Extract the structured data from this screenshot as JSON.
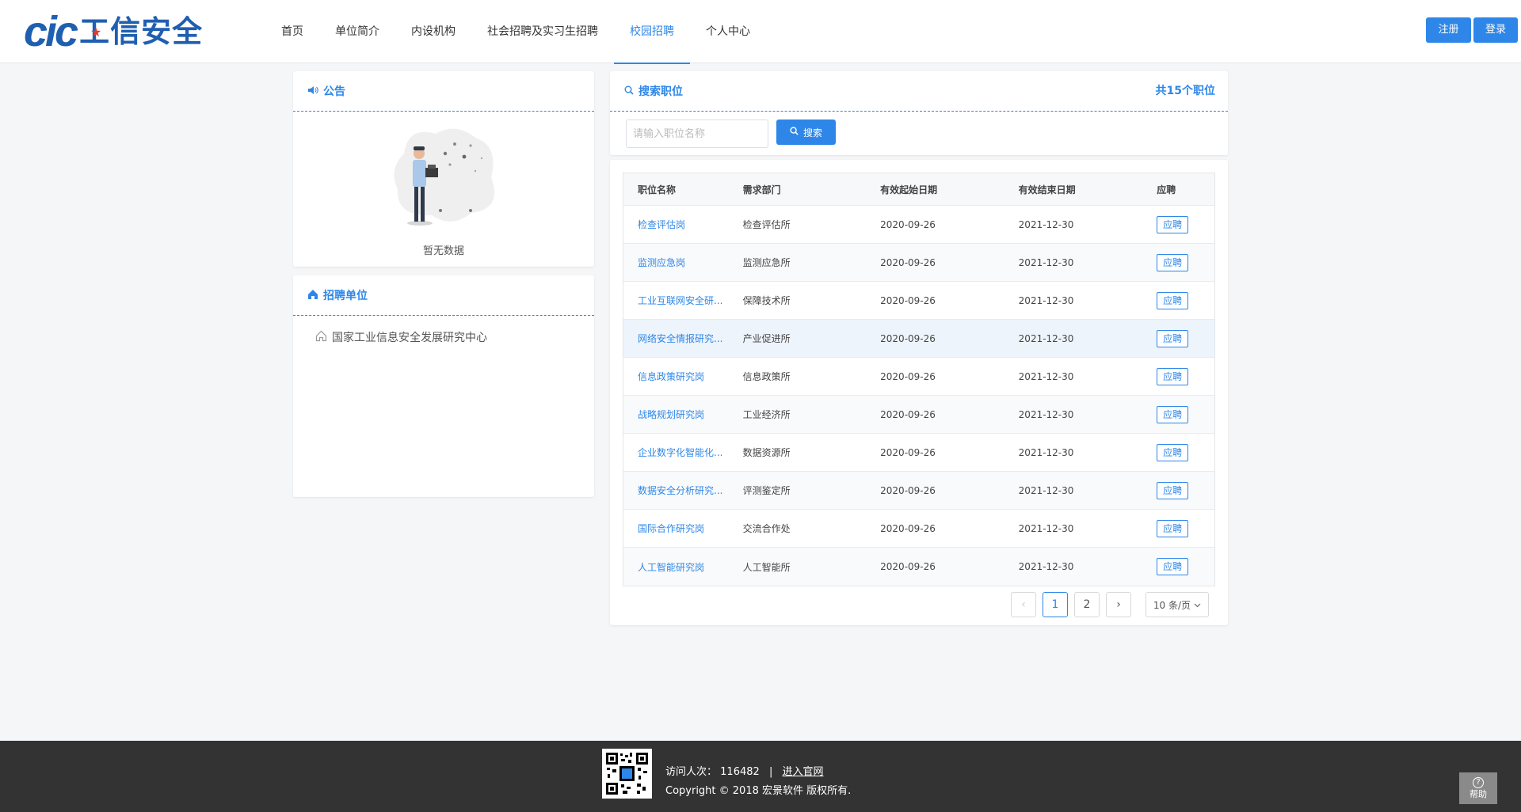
{
  "header": {
    "logo_mark": "cic",
    "logo_text": "工信安全",
    "nav": [
      {
        "label": "首页"
      },
      {
        "label": "单位简介"
      },
      {
        "label": "内设机构"
      },
      {
        "label": "社会招聘及实习生招聘"
      },
      {
        "label": "校园招聘"
      },
      {
        "label": "个人中心"
      }
    ],
    "active_nav": "校园招聘",
    "register_label": "注册",
    "login_label": "登录"
  },
  "notice": {
    "title": "公告",
    "empty_text": "暂无数据",
    "icon": "speaker-icon"
  },
  "units": {
    "title": "招聘单位",
    "icon": "home-icon",
    "items": [
      {
        "label": "国家工业信息安全发展研究中心"
      }
    ]
  },
  "search": {
    "title": "搜索职位",
    "count_text": "共15个职位",
    "placeholder": "请输入职位名称",
    "value": "",
    "button_label": "搜索"
  },
  "table": {
    "columns": [
      "职位名称",
      "需求部门",
      "有效起始日期",
      "有效结束日期",
      "应聘"
    ],
    "rows": [
      {
        "name": "检查评估岗",
        "dept": "检查评估所",
        "start": "2020-09-26",
        "end": "2021-12-30",
        "action": "应聘"
      },
      {
        "name": "监测应急岗",
        "dept": "监测应急所",
        "start": "2020-09-26",
        "end": "2021-12-30",
        "action": "应聘"
      },
      {
        "name": "工业互联网安全研...",
        "dept": "保障技术所",
        "start": "2020-09-26",
        "end": "2021-12-30",
        "action": "应聘"
      },
      {
        "name": "网络安全情报研究...",
        "dept": "产业促进所",
        "start": "2020-09-26",
        "end": "2021-12-30",
        "action": "应聘"
      },
      {
        "name": "信息政策研究岗",
        "dept": "信息政策所",
        "start": "2020-09-26",
        "end": "2021-12-30",
        "action": "应聘"
      },
      {
        "name": "战略规划研究岗",
        "dept": "工业经济所",
        "start": "2020-09-26",
        "end": "2021-12-30",
        "action": "应聘"
      },
      {
        "name": "企业数字化智能化...",
        "dept": "数据资源所",
        "start": "2020-09-26",
        "end": "2021-12-30",
        "action": "应聘"
      },
      {
        "name": "数据安全分析研究...",
        "dept": "评测鉴定所",
        "start": "2020-09-26",
        "end": "2021-12-30",
        "action": "应聘"
      },
      {
        "name": "国际合作研究岗",
        "dept": "交流合作处",
        "start": "2020-09-26",
        "end": "2021-12-30",
        "action": "应聘"
      },
      {
        "name": "人工智能研究岗",
        "dept": "人工智能所",
        "start": "2020-09-26",
        "end": "2021-12-30",
        "action": "应聘"
      }
    ]
  },
  "pagination": {
    "prev": "‹",
    "pages": [
      "1",
      "2"
    ],
    "current": "1",
    "next": "›",
    "page_size": "10 条/页"
  },
  "footer": {
    "visits_label": "访问人次：",
    "visits_count": "116482",
    "separator": "|",
    "official_link": "进入官网",
    "copyright": "Copyright © 2018 宏景软件 版权所有.",
    "help_label": "帮助"
  },
  "colors": {
    "accent": "#2e87e8",
    "brand": "#1f5fb0",
    "footer_bg": "#333333"
  }
}
